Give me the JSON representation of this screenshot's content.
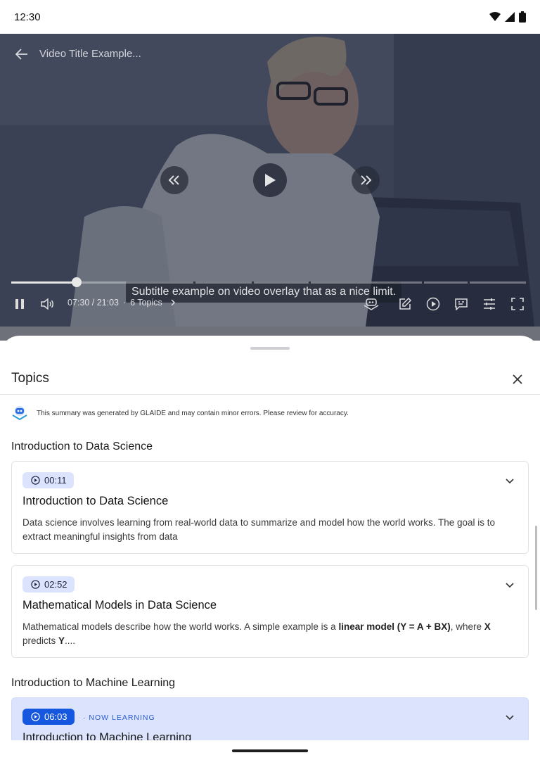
{
  "status_bar": {
    "time": "12:30"
  },
  "video": {
    "title": "Video Title Example...",
    "subtitle": "Subtitle example on video overlay that as a nice limit.",
    "time": "07:30 / 21:03",
    "separator": "·",
    "topics": "6 Topics",
    "progress_fraction": 0.127
  },
  "sheet": {
    "title": "Topics",
    "disclaimer": "This summary was generated by GLAIDE and may contain minor errors. Please review for accuracy.",
    "sections": [
      {
        "title": "Introduction to Data Science",
        "cards": [
          {
            "time": "00:11",
            "title": "Introduction to Data Science",
            "body": "Data science involves learning from real-world data to summarize and model how the world works. The goal is to extract meaningful insights from data"
          },
          {
            "time": "02:52",
            "title": "Mathematical Models in Data Science",
            "body_parts": [
              "Mathematical models describe how the world works. A simple example is a ",
              "linear model (Y = A + BX)",
              ", where ",
              "X",
              " predicts ",
              "Y",
              "...."
            ]
          }
        ]
      },
      {
        "title": "Introduction to Machine Learning",
        "cards": [
          {
            "time": "06:03",
            "status": "· NOW LEARNING",
            "title": "Introduction to Machine Learning"
          }
        ]
      }
    ]
  },
  "colors": {
    "accent": "#1657e0",
    "active_card": "#dbe3fd",
    "pill": "#dce4fd"
  }
}
